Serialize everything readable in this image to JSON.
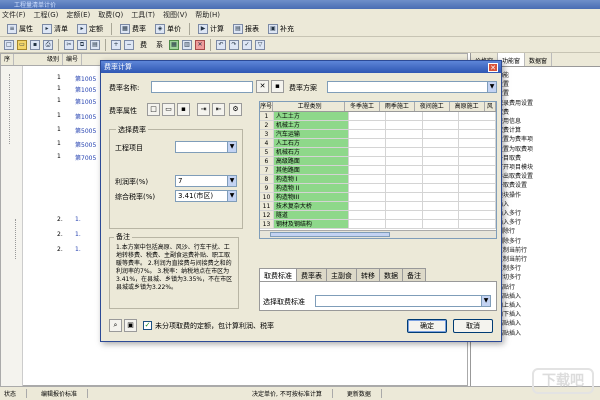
{
  "app": {
    "title": "工程量清单计价",
    "menu": [
      "文件(F)",
      "工程(G)",
      "定额(E)",
      "取费(Q)",
      "工具(T)",
      "视图(V)",
      "帮助(H)"
    ],
    "toolbar": [
      {
        "label": "属性",
        "icon": "doc-icon"
      },
      {
        "label": "清单",
        "icon": "list-icon"
      },
      {
        "label": "定额",
        "icon": "quota-icon"
      },
      {
        "label": "费率",
        "icon": "rate-icon"
      },
      {
        "label": "单价",
        "icon": "price-icon"
      },
      {
        "label": "计算",
        "icon": "play-icon"
      },
      {
        "label": "报表",
        "icon": "report-icon"
      },
      {
        "label": "补充",
        "icon": "supplement-icon"
      }
    ],
    "toolbar2_labels": [
      "费",
      "系"
    ],
    "grid_header": [
      "序",
      "级别",
      "编号"
    ],
    "grid_rows": [
      {
        "level": "1",
        "code": "第1005"
      },
      {
        "level": "1",
        "code": "第1005"
      },
      {
        "level": "1",
        "code": "第1005"
      },
      {
        "level": "1",
        "code": "第1005"
      },
      {
        "level": "1",
        "code": "第5005"
      },
      {
        "level": "1",
        "code": "第5005"
      },
      {
        "level": "1",
        "code": "第7005"
      },
      {
        "level": "2.",
        "code": "1."
      },
      {
        "level": "2.",
        "code": "1."
      },
      {
        "level": "2.",
        "code": "1."
      }
    ],
    "right_tabs": [
      "价格窗",
      "功能窗",
      "数据窗"
    ],
    "right_items": [
      "功能",
      "设置",
      "设置",
      "记录费用设置",
      "取费",
      "费用信息",
      "取费计算",
      "设置为费率项",
      "设置为取费项",
      "子目取费",
      "打开项目模块",
      "导出取费设置",
      "一取费设置",
      "模块操作",
      "插入",
      "插入多行",
      "插入多行",
      "删除行",
      "删除多行",
      "复制当前行",
      "复制当前行",
      "复制多行",
      "剪切多行",
      "粘贴行",
      "粘贴插入",
      "向上插入",
      "向下插入",
      "粘贴插入",
      "粘贴插入"
    ],
    "status": [
      "状态",
      "编辑报价标准",
      "决定单价, 不可按标准计算",
      "更新数据"
    ],
    "watermark": "下载吧"
  },
  "dialog": {
    "title": "费率计算",
    "rate_name_label": "费率名称:",
    "rate_name_value": "",
    "rate_plan_label": "费率方案",
    "rate_plan_value": "",
    "rate_attr_label": "费率属性",
    "select_group_title": "选择费率",
    "project_label": "工程项目",
    "project_value": "",
    "profit_label": "利润率(%)",
    "profit_value": "7",
    "tax_label": "综合税率(%)",
    "tax_value": "3.41(市区)",
    "notes_title": "备注",
    "notes_text": "1.本方案中包括高原、风沙、行车干扰、工地转移费、税费、主副食运费补贴、职工取暖等费率。 2.利润为直接费与间接费之和的利润率的7%。 3.税率：纳税地点在市区为3.41%，在县城、乡镇为3.35%，不在市区县城或乡镇为3.22%。",
    "table_header": [
      "序号",
      "工程类别",
      "冬季施工",
      "雨季施工",
      "夜间施工",
      "高原施工",
      "风"
    ],
    "table_rows": [
      {
        "no": "1",
        "name": "人工土方"
      },
      {
        "no": "2",
        "name": "机械土方"
      },
      {
        "no": "3",
        "name": "汽车运输"
      },
      {
        "no": "4",
        "name": "人工石方"
      },
      {
        "no": "5",
        "name": "机械石方"
      },
      {
        "no": "6",
        "name": "高级路面"
      },
      {
        "no": "7",
        "name": "其他路面"
      },
      {
        "no": "8",
        "name": "构造物 I"
      },
      {
        "no": "9",
        "name": "构造物 II"
      },
      {
        "no": "10",
        "name": "构造物III"
      },
      {
        "no": "11",
        "name": "技术复杂大桥"
      },
      {
        "no": "12",
        "name": "隧道"
      },
      {
        "no": "13",
        "name": "钢材及钢结构"
      }
    ],
    "tabs": [
      "取费标准",
      "费率表",
      "主副食",
      "转移",
      "数据",
      "备注"
    ],
    "select_std_label": "选择取费标准",
    "select_std_value": "",
    "checkbox_label": "未分项取费的定额，包计算利润、税率",
    "ok_label": "确定",
    "cancel_label": "取消"
  }
}
